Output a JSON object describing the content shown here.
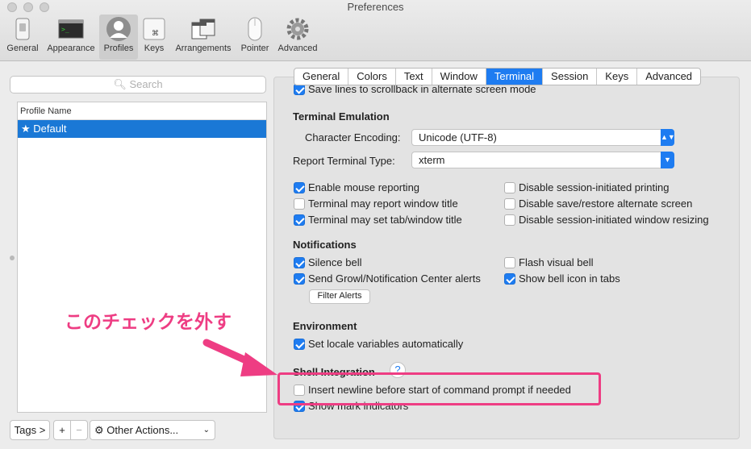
{
  "window": {
    "title": "Preferences"
  },
  "toolbar": {
    "items": [
      {
        "label": "General",
        "icon": "general-icon"
      },
      {
        "label": "Appearance",
        "icon": "appearance-icon"
      },
      {
        "label": "Profiles",
        "icon": "profiles-icon",
        "selected": true
      },
      {
        "label": "Keys",
        "icon": "keys-icon"
      },
      {
        "label": "Arrangements",
        "icon": "arrangements-icon"
      },
      {
        "label": "Pointer",
        "icon": "pointer-icon"
      },
      {
        "label": "Advanced",
        "icon": "advanced-icon"
      }
    ]
  },
  "sidebar": {
    "search_placeholder": "Search",
    "column_header": "Profile Name",
    "profiles": [
      {
        "name": "★ Default",
        "selected": true
      }
    ],
    "bottom": {
      "tags_label": "Tags >",
      "add_label": "+",
      "remove_label": "−",
      "other_actions_label": "Other Actions..."
    }
  },
  "tabs": [
    {
      "label": "General"
    },
    {
      "label": "Colors"
    },
    {
      "label": "Text"
    },
    {
      "label": "Window"
    },
    {
      "label": "Terminal",
      "active": true
    },
    {
      "label": "Session"
    },
    {
      "label": "Keys"
    },
    {
      "label": "Advanced"
    }
  ],
  "terminal": {
    "cut_off_option": "Save lines to scrollback in alternate screen mode",
    "emulation": {
      "title": "Terminal Emulation",
      "encoding_label": "Character Encoding:",
      "encoding_value": "Unicode (UTF-8)",
      "type_label": "Report Terminal Type:",
      "type_value": "xterm",
      "options_left": [
        {
          "label": "Enable mouse reporting",
          "checked": true
        },
        {
          "label": "Terminal may report window title",
          "checked": false
        },
        {
          "label": "Terminal may set tab/window title",
          "checked": true
        }
      ],
      "options_right": [
        {
          "label": "Disable session-initiated printing",
          "checked": false
        },
        {
          "label": "Disable save/restore alternate screen",
          "checked": false
        },
        {
          "label": "Disable session-initiated window resizing",
          "checked": false
        }
      ]
    },
    "notifications": {
      "title": "Notifications",
      "options_left": [
        {
          "label": "Silence bell",
          "checked": true
        },
        {
          "label": "Send Growl/Notification Center alerts",
          "checked": true
        }
      ],
      "options_right": [
        {
          "label": "Flash visual bell",
          "checked": false
        },
        {
          "label": "Show bell icon in tabs",
          "checked": true
        }
      ],
      "filter_button": "Filter Alerts"
    },
    "environment": {
      "title": "Environment",
      "option": {
        "label": "Set locale variables automatically",
        "checked": true
      }
    },
    "shell_integration": {
      "title": "Shell Integration",
      "help": "?",
      "options": [
        {
          "label": "Insert newline before start of command prompt if needed",
          "checked": false
        },
        {
          "label": "Show mark indicators",
          "checked": true
        }
      ]
    }
  },
  "annotation": {
    "text": "このチェックを外す",
    "color": "#ee3d83"
  },
  "colors": {
    "accent": "#1e7cf1",
    "selection": "#1a78d6"
  }
}
